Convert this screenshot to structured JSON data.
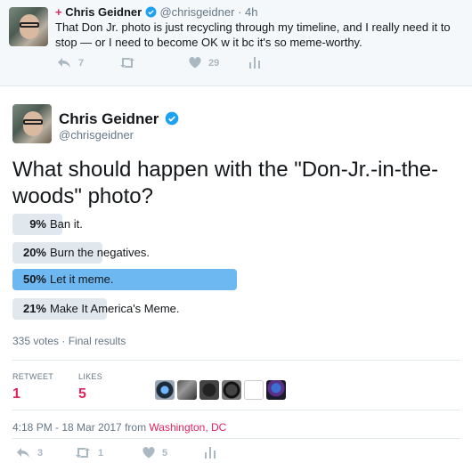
{
  "parent_tweet": {
    "plus": "+",
    "name": "Chris Geidner",
    "handle": "@chrisgeidner",
    "time": "· 4h",
    "text": "That Don Jr. photo is just recycling through my timeline, and I really need it to stop — or I need to become OK w it bc it's so meme-worthy.",
    "replies": "7",
    "retweets": "",
    "likes": "29"
  },
  "tweet": {
    "name": "Chris Geidner",
    "handle": "@chrisgeidner",
    "question": "What should happen with the \"Don-Jr.-in-the-woods\" photo?",
    "poll": {
      "options": [
        {
          "pct": "9%",
          "label": "Ban it.",
          "value": 9
        },
        {
          "pct": "20%",
          "label": "Burn the negatives.",
          "value": 20
        },
        {
          "pct": "50%",
          "label": "Let it meme.",
          "value": 50,
          "winner": true
        },
        {
          "pct": "21%",
          "label": "Make It America's Meme.",
          "value": 21
        }
      ],
      "votes": "335 votes",
      "status": "· Final results"
    },
    "stats": {
      "retweets_label": "RETWEET",
      "retweets_value": "1",
      "likes_label": "LIKES",
      "likes_value": "5"
    },
    "timestamp": "4:18 PM - 18 Mar 2017 from ",
    "location": "Washington, DC",
    "actions": {
      "replies": "3",
      "retweets": "1",
      "likes": "5"
    }
  },
  "colors": {
    "accent": "#55acee",
    "like_red": "#e0245e",
    "muted": "#657786",
    "icon_gray": "#aab8c2"
  }
}
